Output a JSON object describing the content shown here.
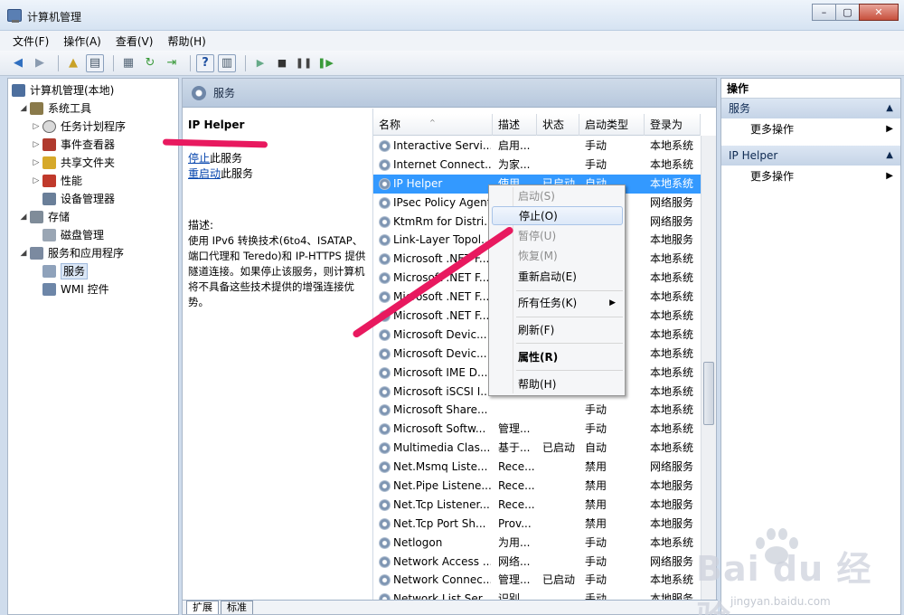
{
  "window": {
    "title": "计算机管理",
    "buttons": [
      "–",
      "▢",
      "✕"
    ]
  },
  "menu": [
    "文件(F)",
    "操作(A)",
    "查看(V)",
    "帮助(H)"
  ],
  "tree": [
    {
      "label": "计算机管理(本地)",
      "level": 0,
      "expander": "",
      "icon": "computer-icon"
    },
    {
      "label": "系统工具",
      "level": 1,
      "expander": "◢",
      "icon": "tools-icon"
    },
    {
      "label": "任务计划程序",
      "level": 2,
      "expander": "▷",
      "icon": "clock-icon"
    },
    {
      "label": "事件查看器",
      "level": 2,
      "expander": "▷",
      "icon": "event-viewer-icon"
    },
    {
      "label": "共享文件夹",
      "level": 2,
      "expander": "▷",
      "icon": "shared-folder-icon"
    },
    {
      "label": "性能",
      "level": 2,
      "expander": "▷",
      "icon": "performance-icon"
    },
    {
      "label": "设备管理器",
      "level": 2,
      "expander": "",
      "icon": "device-manager-icon"
    },
    {
      "label": "存储",
      "level": 1,
      "expander": "◢",
      "icon": "storage-icon"
    },
    {
      "label": "磁盘管理",
      "level": 2,
      "expander": "",
      "icon": "disk-icon"
    },
    {
      "label": "服务和应用程序",
      "level": 1,
      "expander": "◢",
      "icon": "services-apps-icon"
    },
    {
      "label": "服务",
      "level": 2,
      "expander": "",
      "icon": "services-icon",
      "selected": true
    },
    {
      "label": "WMI 控件",
      "level": 2,
      "expander": "",
      "icon": "wmi-icon"
    }
  ],
  "center": {
    "header": "服务",
    "selected_service": "IP Helper",
    "stop_link": "停止",
    "stop_suffix": "此服务",
    "restart_link": "重启动",
    "restart_suffix": "此服务",
    "desc_label": "描述:",
    "desc_text": "使用 IPv6 转换技术(6to4、ISATAP、端口代理和 Teredo)和 IP-HTTPS 提供隧道连接。如果停止该服务，则计算机将不具备这些技术提供的增强连接优势。"
  },
  "columns": [
    "名称",
    "描述",
    "状态",
    "启动类型",
    "登录为"
  ],
  "services": [
    {
      "name": "Interactive Servi...",
      "desc": "启用...",
      "status": "",
      "startup": "手动",
      "logon": "本地系统"
    },
    {
      "name": "Internet Connect...",
      "desc": "为家...",
      "status": "",
      "startup": "手动",
      "logon": "本地系统"
    },
    {
      "name": "IP Helper",
      "desc": "使用...",
      "status": "已启动",
      "startup": "自动",
      "logon": "本地系统",
      "selected": true
    },
    {
      "name": "IPsec Policy Agent",
      "desc": "",
      "status": "",
      "startup": "",
      "logon": "网络服务"
    },
    {
      "name": "KtmRm for Distri...",
      "desc": "",
      "status": "",
      "startup": "",
      "logon": "网络服务"
    },
    {
      "name": "Link-Layer Topol...",
      "desc": "",
      "status": "",
      "startup": "",
      "logon": "本地服务"
    },
    {
      "name": "Microsoft .NET F...",
      "desc": "",
      "status": "",
      "startup": "",
      "logon": "本地系统"
    },
    {
      "name": "Microsoft .NET F...",
      "desc": "",
      "status": "",
      "startup": "",
      "logon": "本地系统"
    },
    {
      "name": "Microsoft .NET F...",
      "desc": "",
      "status": "",
      "startup": "",
      "logon": "本地系统"
    },
    {
      "name": "Microsoft .NET F...",
      "desc": "",
      "status": "",
      "startup": "",
      "logon": "本地系统"
    },
    {
      "name": "Microsoft Devic...",
      "desc": "",
      "status": "",
      "startup": "",
      "logon": "本地系统"
    },
    {
      "name": "Microsoft Devic...",
      "desc": "",
      "status": "",
      "startup": "",
      "logon": "本地系统"
    },
    {
      "name": "Microsoft IME D...",
      "desc": "",
      "status": "",
      "startup": "",
      "logon": "本地系统"
    },
    {
      "name": "Microsoft iSCSI I...",
      "desc": "",
      "status": "",
      "startup": "",
      "logon": "本地系统"
    },
    {
      "name": "Microsoft Share...",
      "desc": "",
      "status": "",
      "startup": "手动",
      "logon": "本地系统"
    },
    {
      "name": "Microsoft Softw...",
      "desc": "管理...",
      "status": "",
      "startup": "手动",
      "logon": "本地系统"
    },
    {
      "name": "Multimedia Clas...",
      "desc": "基于...",
      "status": "已启动",
      "startup": "自动",
      "logon": "本地系统"
    },
    {
      "name": "Net.Msmq Liste...",
      "desc": "Rece...",
      "status": "",
      "startup": "禁用",
      "logon": "网络服务"
    },
    {
      "name": "Net.Pipe Listene...",
      "desc": "Rece...",
      "status": "",
      "startup": "禁用",
      "logon": "本地服务"
    },
    {
      "name": "Net.Tcp Listener...",
      "desc": "Rece...",
      "status": "",
      "startup": "禁用",
      "logon": "本地服务"
    },
    {
      "name": "Net.Tcp Port Sh...",
      "desc": "Prov...",
      "status": "",
      "startup": "禁用",
      "logon": "本地服务"
    },
    {
      "name": "Netlogon",
      "desc": "为用...",
      "status": "",
      "startup": "手动",
      "logon": "本地系统"
    },
    {
      "name": "Network Access ...",
      "desc": "网络...",
      "status": "",
      "startup": "手动",
      "logon": "网络服务"
    },
    {
      "name": "Network Connec...",
      "desc": "管理...",
      "status": "已启动",
      "startup": "手动",
      "logon": "本地系统"
    },
    {
      "name": "Network List Ser...",
      "desc": "识别...",
      "status": "",
      "startup": "手动",
      "logon": "本地服务"
    }
  ],
  "context_menu": [
    {
      "label": "启动(S)",
      "disabled": true
    },
    {
      "label": "停止(O)",
      "highlighted": true
    },
    {
      "label": "暂停(U)",
      "disabled": true
    },
    {
      "label": "恢复(M)",
      "disabled": true
    },
    {
      "label": "重新启动(E)"
    },
    {
      "label": "所有任务(K)",
      "submenu": true
    },
    {
      "label": "刷新(F)"
    },
    {
      "label": "属性(R)",
      "bold": true
    },
    {
      "label": "帮助(H)"
    }
  ],
  "tabs": [
    "扩展",
    "标准"
  ],
  "actions": {
    "title": "操作",
    "sections": [
      {
        "label": "服务",
        "item": "更多操作"
      },
      {
        "label": "IP Helper",
        "item": "更多操作"
      }
    ]
  },
  "watermark": {
    "brand": "Bai du 经验",
    "url": "jingyan.baidu.com"
  },
  "colors": {
    "selection": "#3399ff",
    "annotation": "#e8195f",
    "link": "#0645ad"
  }
}
